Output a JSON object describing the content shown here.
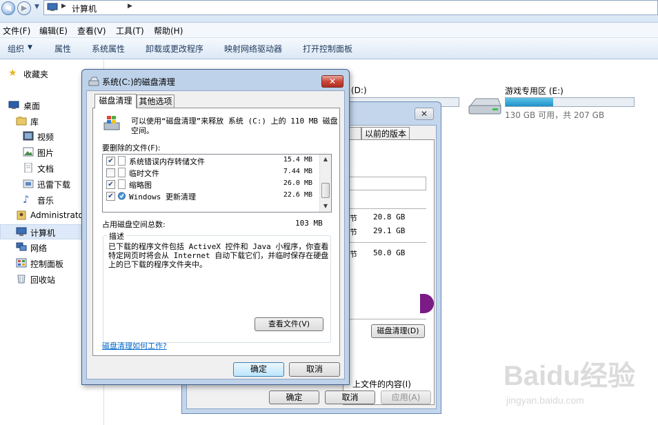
{
  "address_bar": {
    "back_arrow": "◀",
    "forward_arrow": "▶",
    "history_arrow": "▼",
    "crumb_separator": "▶",
    "location": "计算机"
  },
  "menu": [
    "文件(F)",
    "编辑(E)",
    "查看(V)",
    "工具(T)",
    "帮助(H)"
  ],
  "toolbar": {
    "organize": "组织",
    "organize_arrow": "▼",
    "items": [
      "属性",
      "系统属性",
      "卸载或更改程序",
      "映射网络驱动器",
      "打开控制面板"
    ]
  },
  "nav": {
    "favorites": "收藏夹",
    "desktop": "桌面",
    "libraries": "库",
    "videos": "视频",
    "pictures": "图片",
    "documents": "文档",
    "thunder": "迅雷下载",
    "music": "音乐",
    "admin": "Administrator",
    "computer": "计算机",
    "network": "网络",
    "control_panel": "控制面板",
    "recycle": "回收站"
  },
  "drives": {
    "d_label": "(D:)",
    "e_label": "游戏专用区 (E:)",
    "e_info": "130 GB 可用，共 207 GB",
    "e_used_fraction": 0.37
  },
  "properties_window": {
    "close": "✕",
    "tab_previous": "以前的版本",
    "values": [
      "20.8 GB",
      "29.1 GB",
      "50.0 GB"
    ],
    "fang": "节",
    "cleanup_button": "磁盘清理(D)",
    "compress_text": "上文件的内容(I)",
    "ok": "确定",
    "cancel": "取消",
    "apply": "应用(A)"
  },
  "dialog": {
    "title": "系统(C:)的磁盘清理",
    "close": "✕",
    "tabs": [
      "磁盘清理",
      "其他选项"
    ],
    "info": "可以使用“磁盘清理”来释放 系统 (C:) 上的 110 MB 磁盘空间。",
    "files_label": "要删除的文件(F):",
    "files": [
      {
        "name": "系统错误内存转储文件",
        "size": "15.4 MB",
        "checked": true
      },
      {
        "name": "临时文件",
        "size": "7.44 MB",
        "checked": false
      },
      {
        "name": "缩略图",
        "size": "26.0 MB",
        "checked": true
      },
      {
        "name": "Windows 更新清理",
        "size": "22.6 MB",
        "checked": true
      }
    ],
    "scroll_up": "▲",
    "scroll_down": "▼",
    "total_label": "占用磁盘空间总数:",
    "total_value": "103 MB",
    "desc_title": "描述",
    "desc_text": "已下载的程序文件包括 ActiveX 控件和 Java 小程序，你查看特定网页时将会从 Internet 自动下载它们，并临时保存在硬盘上的已下载的程序文件夹中。",
    "view_files": "查看文件(V)",
    "help_link": "磁盘清理如何工作?",
    "ok": "确定",
    "cancel": "取消"
  },
  "watermark": {
    "logo": "Baidu经验",
    "url": "jingyan.baidu.com"
  },
  "colors": {
    "drive_bar": "#1f91c8",
    "link": "#0066cc",
    "close_red": "#c8493a"
  }
}
